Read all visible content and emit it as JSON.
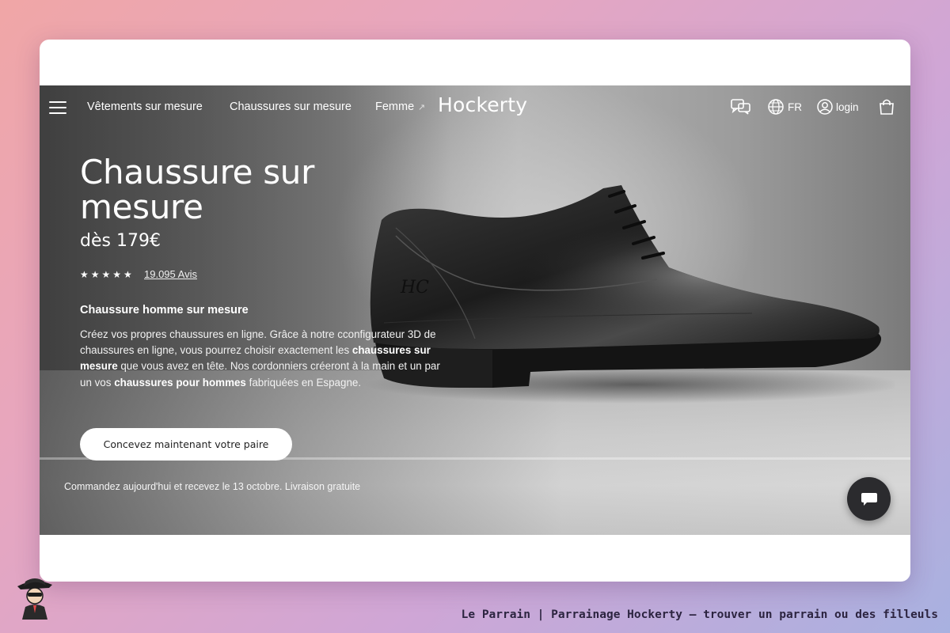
{
  "nav": {
    "menu_icon": "hamburger-icon",
    "links": [
      {
        "label": "Vêtements sur mesure"
      },
      {
        "label": "Chaussures sur mesure"
      },
      {
        "label": "Femme",
        "icon": "external-link-icon"
      }
    ],
    "brand": "Hockerty",
    "chat_icon": "chat-bubbles-icon",
    "language_icon": "globe-icon",
    "language": "FR",
    "login_icon": "user-circle-icon",
    "login": "login",
    "cart_icon": "shopping-bag-icon"
  },
  "hero": {
    "title": "Chaussure sur mesure",
    "price": "dès 179€",
    "rating_stars": 5,
    "stars_text": "★★★★★",
    "reviews": "19.095 Avis",
    "subtitle": "Chaussure homme sur mesure",
    "paragraph": {
      "p1": "Créez vos propres chaussures en ligne. Grâce à notre cconfigurateur 3D de chaussures en ligne, vous pourrez choisir exactement les ",
      "b1": "chaussures sur mesure",
      "p2": " que vous avez en tête. Nos cordonniers créeront à la main et un par un vos ",
      "b2": "chaussures pour hommes",
      "p3": " fabriquées en Espagne."
    },
    "cta": "Concevez maintenant votre paire",
    "delivery": "Commandez aujourd'hui et recevez le 13 octobre. Livraison gratuite",
    "monogram": "HC"
  },
  "chat_widget": {
    "icon": "chat-icon"
  },
  "footer": {
    "mascot": "le-parrain-mascot-icon",
    "caption": "Le Parrain | Parrainage Hockerty — trouver un parrain ou des filleuls"
  },
  "colors": {
    "background_start": "#f0a6a6",
    "background_end": "#a8b1e0",
    "chat_button": "#2b2b2e",
    "cta_bg": "#ffffff"
  }
}
